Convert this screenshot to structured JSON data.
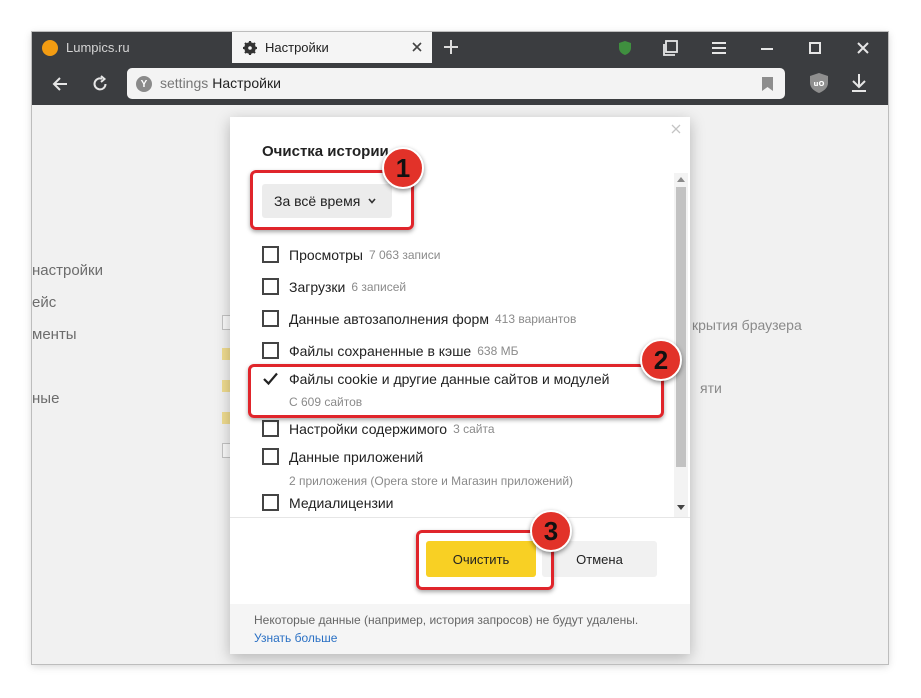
{
  "tabs": [
    {
      "label": "Lumpics.ru",
      "active": false
    },
    {
      "label": "Настройки",
      "active": true
    }
  ],
  "address": {
    "host": "settings",
    "title": "Настройки"
  },
  "background": {
    "sidebar_items": [
      "настройки",
      "ейс",
      "менты",
      "ные"
    ],
    "right_texts": [
      "крытия браузера",
      "яти"
    ]
  },
  "dialog": {
    "title": "Очистка истории",
    "period": "За всё время",
    "items": [
      {
        "label": "Просмотры",
        "count": "7 063 записи",
        "checked": false
      },
      {
        "label": "Загрузки",
        "count": "6 записей",
        "checked": false
      },
      {
        "label": "Данные автозаполнения форм",
        "count": "413 вариантов",
        "checked": false
      },
      {
        "label": "Файлы сохраненные в кэше",
        "count": "638 МБ",
        "checked": false
      },
      {
        "label": "Файлы cookie и другие данные сайтов и модулей",
        "count": "",
        "sub": "С 609 сайтов",
        "checked": true
      },
      {
        "label": "Настройки содержимого",
        "count": "3 сайта",
        "checked": false
      },
      {
        "label": "Данные приложений",
        "count": "",
        "sub": "2 приложения (Opera store и Магазин приложений)",
        "checked": false
      },
      {
        "label": "Медиалицензии",
        "count": "",
        "checked": false
      }
    ],
    "clear_button": "Очистить",
    "cancel_button": "Отмена",
    "note": "Некоторые данные (например, история запросов) не будут удалены.",
    "learn_more": "Узнать больше"
  },
  "annotations": [
    "1",
    "2",
    "3"
  ],
  "colors": {
    "accent": "#f8d024",
    "annotation": "#e0252b",
    "link": "#2a70c4",
    "chrome": "#3b3d40"
  }
}
